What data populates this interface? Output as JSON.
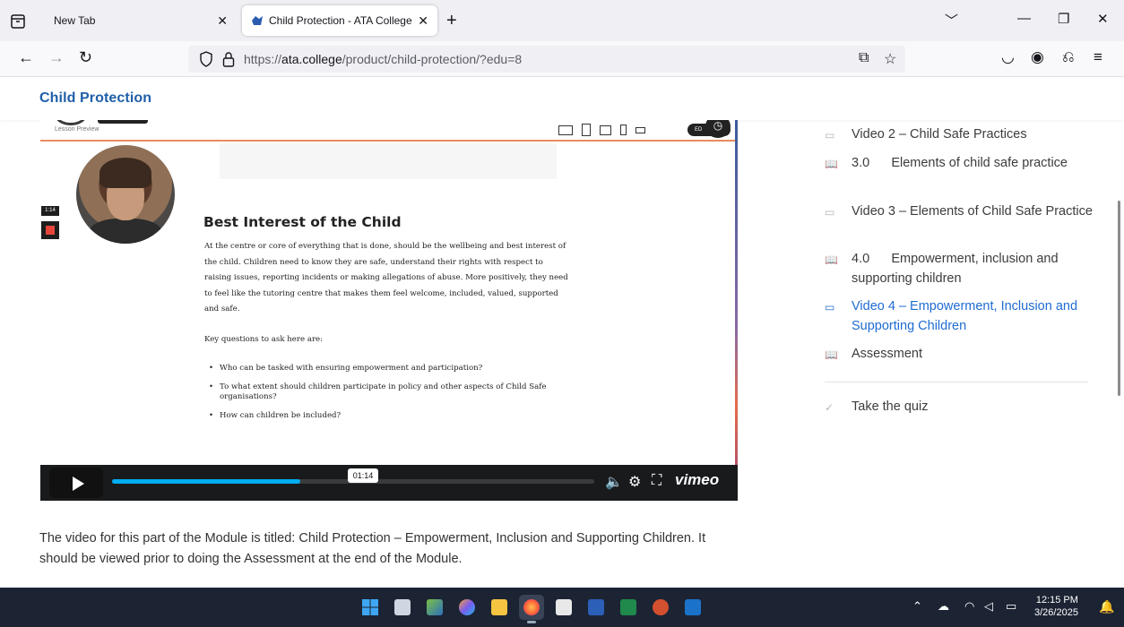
{
  "browser": {
    "tabs": [
      {
        "label": "New Tab",
        "active": false
      },
      {
        "label": "Child Protection - ATA College",
        "active": true
      }
    ],
    "url_host": "ata.college",
    "url_prefix": "https://",
    "url_path": "/product/child-protection/?edu=8",
    "icons": [
      "tab-overview-icon",
      "back-icon",
      "forward-icon",
      "reload-icon",
      "shield-icon",
      "lock-icon",
      "reader-view-icon",
      "bookmark-star-icon",
      "pocket-icon",
      "account-icon",
      "extensions-icon",
      "menu-icon"
    ]
  },
  "site": {
    "title": "Child Protection"
  },
  "video": {
    "lesson_preview": "Lesson Preview",
    "badge": "ED",
    "mini_time": "1:14",
    "slide": {
      "title": "Best Interest of the Child",
      "body": "At the centre or core of everything that is done, should be the wellbeing and best interest of the child. Children need to know they are safe, understand their rights with respect to raising issues, reporting incidents or making allegations of abuse. More positively, they need to feel like the tutoring centre that makes them feel welcome, included, valued, supported and safe.",
      "subheading": "Key questions to ask here are:",
      "bullets": [
        "Who can be tasked with ensuring empowerment and participation?",
        "To what extent should children participate in policy and other aspects of Child Safe organisations?",
        "How can children be included?"
      ]
    },
    "player": {
      "current_time": "01:14",
      "progress": 0.39,
      "brand": "vimeo"
    }
  },
  "description": "The video for this part of the Module is titled: Child Protection – Empowerment, Inclusion and Supporting Children. It should be viewed prior to doing the Assessment at the end of the Module.",
  "sidebar": {
    "items": [
      {
        "label": "Video 2 – Child Safe Practices",
        "icon": "video-icon",
        "active": false
      },
      {
        "label": "3.0      Elements of child safe practice",
        "icon": "book-icon",
        "active": false
      },
      {
        "label": "Video 3 – Elements of Child Safe Practice",
        "icon": "video-icon",
        "active": false
      },
      {
        "label": "4.0      Empowerment, inclusion and supporting children",
        "icon": "book-icon",
        "active": false
      },
      {
        "label": "Video 4 – Empowerment, Inclusion and Supporting Children",
        "icon": "video-icon",
        "active": true
      },
      {
        "label": "Assessment",
        "icon": "book-icon",
        "active": false
      }
    ],
    "quiz_label": "Take the quiz"
  },
  "taskbar": {
    "time": "12:15 PM",
    "date": "3/26/2025"
  }
}
